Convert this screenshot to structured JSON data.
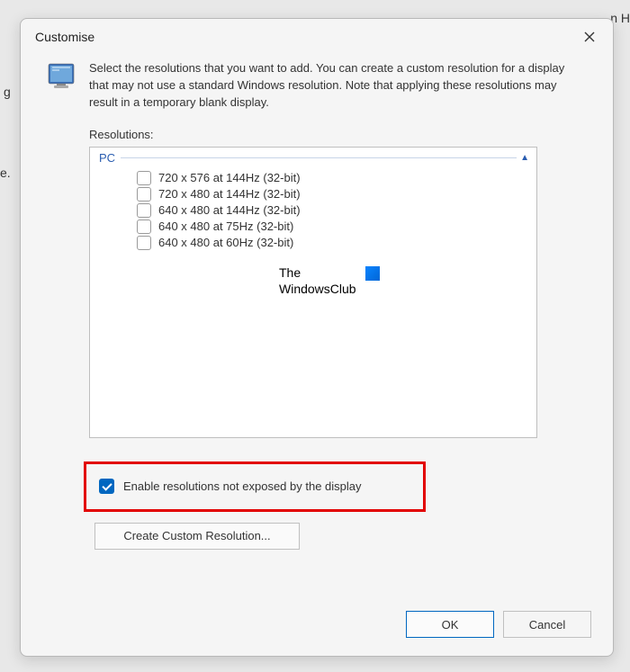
{
  "background": {
    "left_fragment_1": "g",
    "left_fragment_2": "e.",
    "right_fragment": "n H"
  },
  "dialog": {
    "title": "Customise",
    "intro": "Select the resolutions that you want to add. You can create a custom resolution for a display that may not use a standard Windows resolution. Note that applying these resolutions may result in a temporary blank display.",
    "list_label": "Resolutions:",
    "group_name": "PC",
    "resolutions": [
      {
        "label": "720 x 576 at 144Hz (32-bit)"
      },
      {
        "label": "720 x 480 at 144Hz (32-bit)"
      },
      {
        "label": "640 x 480 at 144Hz (32-bit)"
      },
      {
        "label": "640 x 480 at 75Hz (32-bit)"
      },
      {
        "label": "640 x 480 at 60Hz (32-bit)"
      }
    ],
    "enable_checkbox_label": "Enable resolutions not exposed by the display",
    "create_button": "Create Custom Resolution...",
    "ok_button": "OK",
    "cancel_button": "Cancel"
  },
  "watermark": {
    "line1": "The",
    "line2": "WindowsClub"
  }
}
